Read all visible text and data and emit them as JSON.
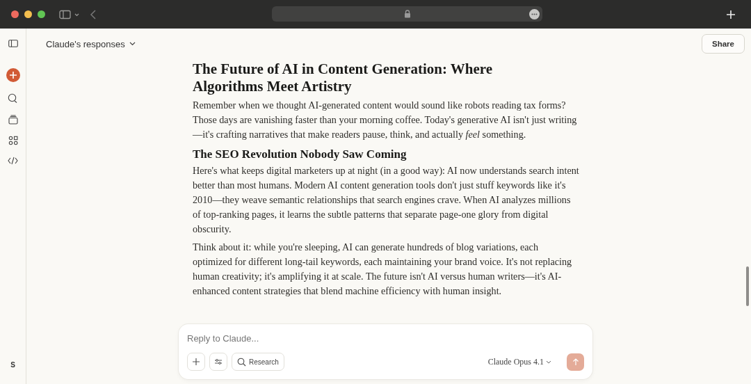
{
  "header": {
    "title": "Claude's responses",
    "share_button": "Share"
  },
  "sidebar": {
    "avatar_initial": "S"
  },
  "article": [
    {
      "kind": "heading1",
      "text": "The Future of AI in Content Generation: Where Algorithms Meet Artistry"
    },
    {
      "kind": "paragraph",
      "text": "Remember when we thought AI-generated content would sound like robots reading tax forms? Those days are vanishing faster than your morning coffee. Today's generative AI isn't just writing—it's crafting narratives that make readers pause, think, and actually *feel* something."
    },
    {
      "kind": "heading2",
      "text": "The SEO Revolution Nobody Saw Coming"
    },
    {
      "kind": "paragraph",
      "text": "Here's what keeps digital marketers up at night (in a good way): AI now understands search intent better than most humans. Modern AI content generation tools don't just stuff keywords like it's 2010—they weave semantic relationships that search engines crave. When AI analyzes millions of top-ranking pages, it learns the subtle patterns that separate page-one glory from digital obscurity."
    },
    {
      "kind": "paragraph",
      "text": "Think about it: while you're sleeping, AI can generate hundreds of blog variations, each optimized for different long-tail keywords, each maintaining your brand voice. It's not replacing human creativity; it's amplifying it at scale. The future isn't AI versus human writers—it's AI-enhanced content strategies that blend machine efficiency with human insight."
    }
  ],
  "composer": {
    "placeholder": "Reply to Claude...",
    "research_button": "Research",
    "model": "Claude Opus 4.1",
    "send_disabled": true
  }
}
